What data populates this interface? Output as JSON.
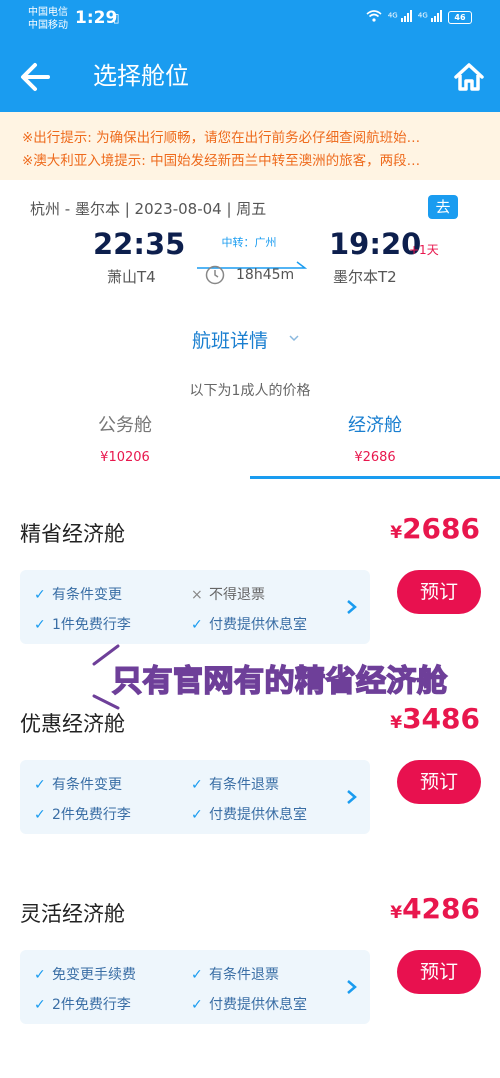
{
  "status_bar": {
    "carrier1": "中国电信",
    "carrier2": "中国移动",
    "time": "1:29",
    "net1": "4G",
    "net2": "4G",
    "battery": "46"
  },
  "header": {
    "title": "选择舱位",
    "back_icon": "arrow-left-icon",
    "home_icon": "home-icon",
    "bg_color": "#1a9cf0"
  },
  "notices": [
    "※出行提示: 为确保出行顺畅，请您在出行前务必仔细查阅航班始…",
    "※澳大利亚入境提示: 中国始发经新西兰中转至澳洲的旅客，两段…"
  ],
  "flight": {
    "route": "杭州 - 墨尔本 | 2023-08-04 | 周五",
    "direction_tag": "去",
    "dep_time": "22:35",
    "dep_airport": "萧山T4",
    "arr_time": "19:20",
    "arr_offset": "+1天",
    "arr_airport": "墨尔本T2",
    "transfer": "中转：广州",
    "duration": "18h45m"
  },
  "details_link": "航班详情",
  "price_note": "以下为1成人的价格",
  "cabins": [
    {
      "name": "公务舱",
      "price": "¥10206",
      "selected": false
    },
    {
      "name": "经济舱",
      "price": "¥2686",
      "selected": true
    }
  ],
  "fares": [
    {
      "name": "精省经济舱",
      "currency": "¥",
      "price": "2686",
      "features": [
        "有条件变更",
        "不得退票",
        "1件免费行李",
        "付费提供休息室"
      ],
      "book_label": "预订"
    },
    {
      "name": "优惠经济舱",
      "currency": "¥",
      "price": "3486",
      "features": [
        "有条件变更",
        "有条件退票",
        "2件免费行李",
        "付费提供休息室"
      ],
      "book_label": "预订"
    },
    {
      "name": "灵活经济舱",
      "currency": "¥",
      "price": "4286",
      "features": [
        "免变更手续费",
        "有条件退票",
        "2件免费行李",
        "付费提供休息室"
      ],
      "book_label": "预订"
    }
  ],
  "annotation": "只有官网有的精省经济舱",
  "colors": {
    "accent": "#1a9cf0",
    "price": "#e8174d",
    "notice": "#ee6a1c"
  }
}
